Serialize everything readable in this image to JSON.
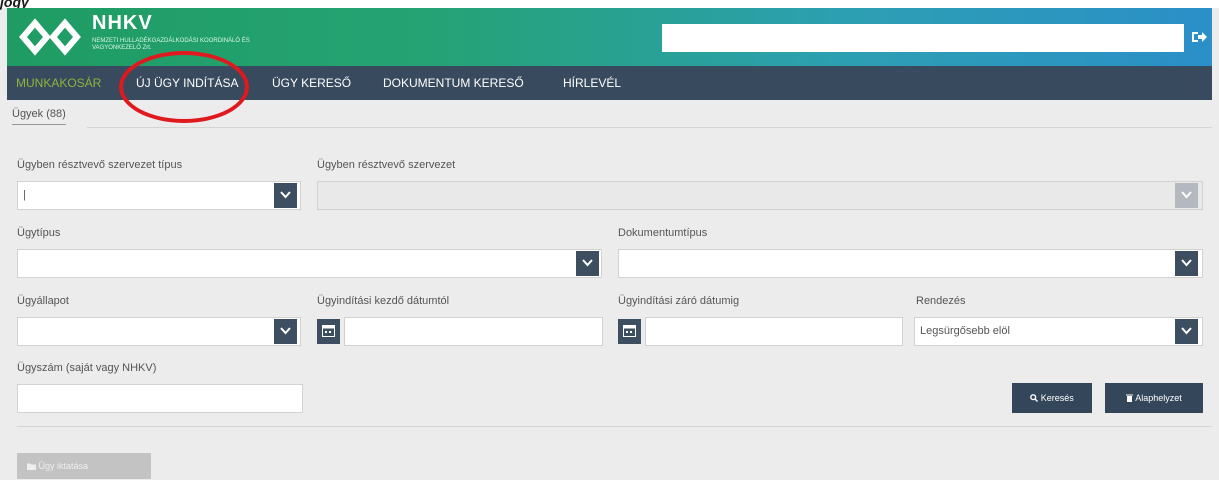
{
  "header": {
    "top_text": "jogy",
    "logo_title": "NHKV",
    "logo_subtitle": "NEMZETI HULLADÉKGAZDÁLKODÁSI KOORDINÁLÓ ÉS VAGYONKEZELŐ Zrt.",
    "search_value": "",
    "logout_icon": "sign-out-icon"
  },
  "nav": {
    "items": [
      {
        "label": "Munkakosár",
        "active": true
      },
      {
        "label": "Új ügy indítása",
        "active": false
      },
      {
        "label": "Ügy kereső",
        "active": false
      },
      {
        "label": "Dokumentum kereső",
        "active": false
      },
      {
        "label": "Hírlevél",
        "active": false
      }
    ]
  },
  "tabs": {
    "cases": "Ügyek (88)"
  },
  "form": {
    "org_type_label": "Ügyben résztvevő szervezet típus",
    "org_type_value": "|",
    "org_label": "Ügyben résztvevő szervezet",
    "org_value": "",
    "case_type_label": "Ügytípus",
    "case_type_value": "",
    "doc_type_label": "Dokumentumtípus",
    "doc_type_value": "",
    "status_label": "Ügyállapot",
    "status_value": "",
    "start_from_label": "Ügyindítási kezdő dátumtól",
    "start_from_value": "",
    "start_to_label": "Ügyindítási záró dátumig",
    "start_to_value": "",
    "sort_label": "Rendezés",
    "sort_value": "Legsürgősebb elöl",
    "case_number_label": "Ügyszám (saját vagy NHKV)",
    "case_number_value": ""
  },
  "actions": {
    "search_label": "Keresés",
    "reset_label": "Alaphelyzet",
    "new_case_label": "Ügy iktatása"
  },
  "colors": {
    "nav_bg": "#374a5e",
    "active_nav": "#8fb33e",
    "button_bg": "#33465a",
    "highlight_circle": "#e0191f"
  }
}
